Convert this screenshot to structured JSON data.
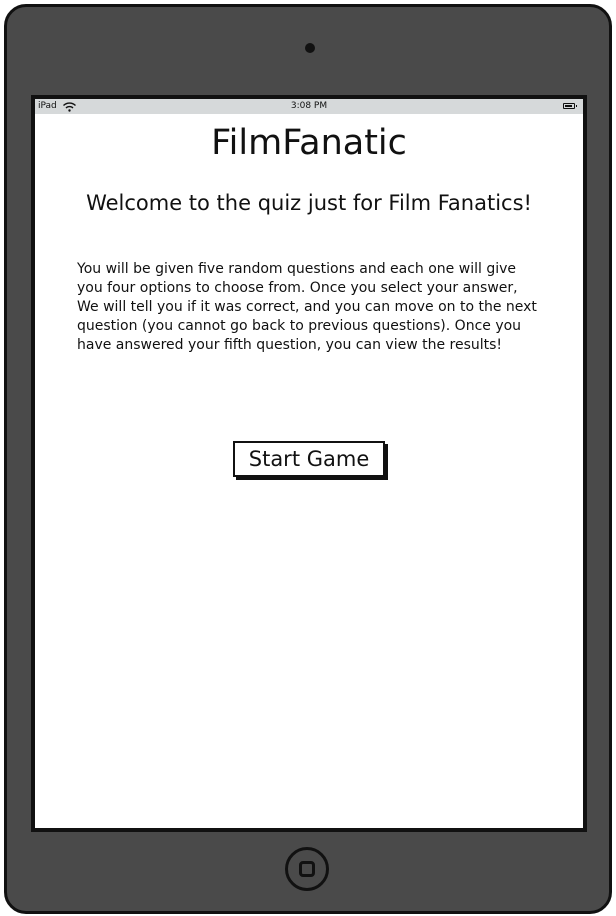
{
  "status_bar": {
    "carrier": "iPad",
    "time": "3:08 PM"
  },
  "app": {
    "title": "FilmFanatic",
    "welcome": "Welcome to the quiz just for Film Fanatics!",
    "instructions": "You will be given five random questions and each one will give you four options to choose from. Once you select your answer, We will tell you if it was correct, and you can move on to the next question (you cannot go back to previous questions). Once you have answered your fifth question, you can view the results!",
    "start_label": "Start Game"
  },
  "icons": {
    "signal": "wifi-icon",
    "battery": "battery-icon",
    "home": "home-button-icon",
    "camera": "camera-icon"
  }
}
